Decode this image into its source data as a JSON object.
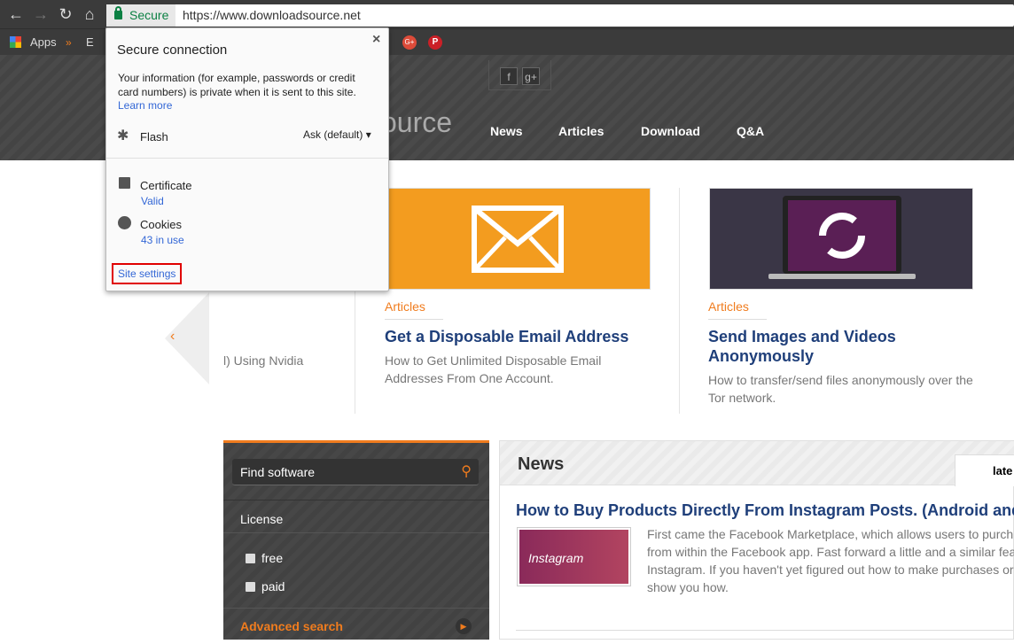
{
  "browser": {
    "secure_label": "Secure",
    "url": "https://www.downloadsource.net",
    "bookmarks": [
      "Apps",
      "E"
    ]
  },
  "site": {
    "logo_partial": "ource",
    "nav": [
      "News",
      "Articles",
      "Download",
      "Q&A"
    ],
    "social": [
      "f",
      "g+"
    ]
  },
  "slider": {
    "partial_title": "l) Using Nvidia"
  },
  "cards": [
    {
      "category": "Articles",
      "title": "Get a Disposable Email Address",
      "desc": "How to Get Unlimited Disposable Email Addresses From One Account.",
      "image_color": "#f39c1f"
    },
    {
      "category": "Articles",
      "title": "Send Images and Videos Anonymously",
      "desc": "How to transfer/send files anonymously over the Tor network.",
      "image_color": "#3a3646"
    }
  ],
  "sidebar": {
    "search_placeholder": "Find software",
    "license_label": "License",
    "options": [
      "free",
      "paid"
    ],
    "advanced": "Advanced search"
  },
  "news": {
    "heading": "News",
    "tab": "late",
    "article_title": "How to Buy Products Directly From Instagram Posts. (Android and",
    "article_desc_lines": [
      "First came the Facebook Marketplace, which allows users to purch",
      "from within the Facebook app. Fast forward a little and a similar fea",
      "Instagram. If you haven't yet figured out how to make purchases or",
      "show you how."
    ],
    "thumb_text": "Instagram"
  },
  "popup": {
    "title": "Secure connection",
    "body": "Your information (for example, passwords or credit card numbers) is private when it is sent to this site.",
    "learn_more": "Learn more",
    "flash_label": "Flash",
    "flash_value": "Ask (default)",
    "certificate_label": "Certificate",
    "certificate_value": "Valid",
    "cookies_label": "Cookies",
    "cookies_value": "43 in use",
    "site_settings": "Site settings",
    "close": "×"
  },
  "colors": {
    "accent": "#f07c1e",
    "link": "#3367d6",
    "title_blue": "#1f3f7a",
    "highlight_box": "#e00000"
  }
}
